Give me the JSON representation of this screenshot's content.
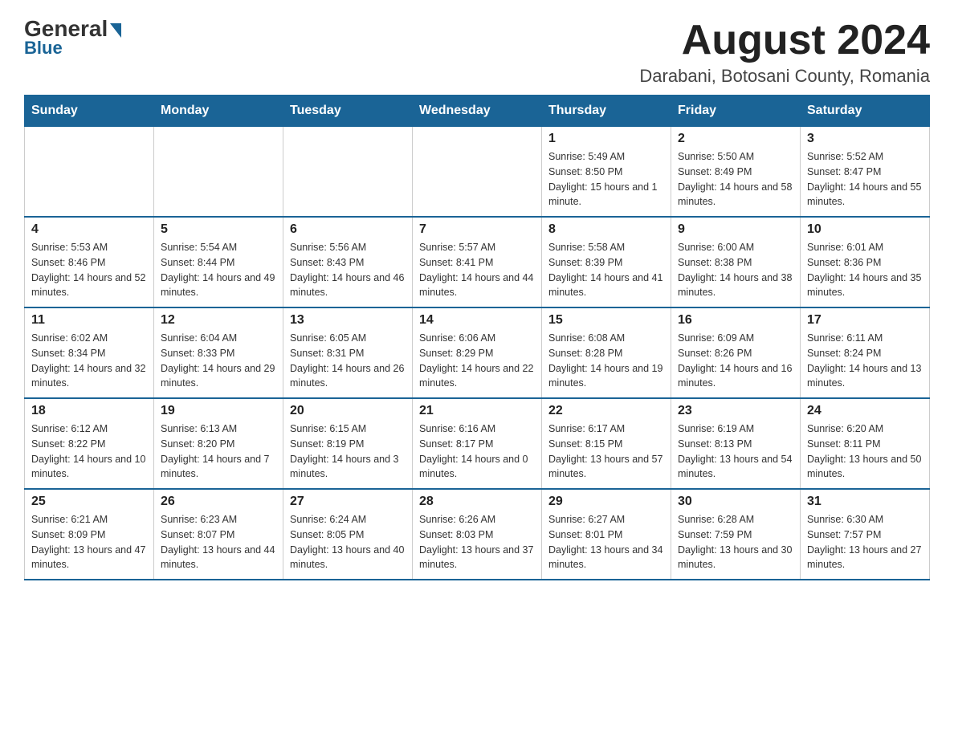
{
  "logo": {
    "general_text": "General",
    "blue_text": "Blue"
  },
  "header": {
    "month_year": "August 2024",
    "location": "Darabani, Botosani County, Romania"
  },
  "days_of_week": [
    "Sunday",
    "Monday",
    "Tuesday",
    "Wednesday",
    "Thursday",
    "Friday",
    "Saturday"
  ],
  "weeks": [
    {
      "days": [
        {
          "number": "",
          "info": ""
        },
        {
          "number": "",
          "info": ""
        },
        {
          "number": "",
          "info": ""
        },
        {
          "number": "",
          "info": ""
        },
        {
          "number": "1",
          "info": "Sunrise: 5:49 AM\nSunset: 8:50 PM\nDaylight: 15 hours and 1 minute."
        },
        {
          "number": "2",
          "info": "Sunrise: 5:50 AM\nSunset: 8:49 PM\nDaylight: 14 hours and 58 minutes."
        },
        {
          "number": "3",
          "info": "Sunrise: 5:52 AM\nSunset: 8:47 PM\nDaylight: 14 hours and 55 minutes."
        }
      ]
    },
    {
      "days": [
        {
          "number": "4",
          "info": "Sunrise: 5:53 AM\nSunset: 8:46 PM\nDaylight: 14 hours and 52 minutes."
        },
        {
          "number": "5",
          "info": "Sunrise: 5:54 AM\nSunset: 8:44 PM\nDaylight: 14 hours and 49 minutes."
        },
        {
          "number": "6",
          "info": "Sunrise: 5:56 AM\nSunset: 8:43 PM\nDaylight: 14 hours and 46 minutes."
        },
        {
          "number": "7",
          "info": "Sunrise: 5:57 AM\nSunset: 8:41 PM\nDaylight: 14 hours and 44 minutes."
        },
        {
          "number": "8",
          "info": "Sunrise: 5:58 AM\nSunset: 8:39 PM\nDaylight: 14 hours and 41 minutes."
        },
        {
          "number": "9",
          "info": "Sunrise: 6:00 AM\nSunset: 8:38 PM\nDaylight: 14 hours and 38 minutes."
        },
        {
          "number": "10",
          "info": "Sunrise: 6:01 AM\nSunset: 8:36 PM\nDaylight: 14 hours and 35 minutes."
        }
      ]
    },
    {
      "days": [
        {
          "number": "11",
          "info": "Sunrise: 6:02 AM\nSunset: 8:34 PM\nDaylight: 14 hours and 32 minutes."
        },
        {
          "number": "12",
          "info": "Sunrise: 6:04 AM\nSunset: 8:33 PM\nDaylight: 14 hours and 29 minutes."
        },
        {
          "number": "13",
          "info": "Sunrise: 6:05 AM\nSunset: 8:31 PM\nDaylight: 14 hours and 26 minutes."
        },
        {
          "number": "14",
          "info": "Sunrise: 6:06 AM\nSunset: 8:29 PM\nDaylight: 14 hours and 22 minutes."
        },
        {
          "number": "15",
          "info": "Sunrise: 6:08 AM\nSunset: 8:28 PM\nDaylight: 14 hours and 19 minutes."
        },
        {
          "number": "16",
          "info": "Sunrise: 6:09 AM\nSunset: 8:26 PM\nDaylight: 14 hours and 16 minutes."
        },
        {
          "number": "17",
          "info": "Sunrise: 6:11 AM\nSunset: 8:24 PM\nDaylight: 14 hours and 13 minutes."
        }
      ]
    },
    {
      "days": [
        {
          "number": "18",
          "info": "Sunrise: 6:12 AM\nSunset: 8:22 PM\nDaylight: 14 hours and 10 minutes."
        },
        {
          "number": "19",
          "info": "Sunrise: 6:13 AM\nSunset: 8:20 PM\nDaylight: 14 hours and 7 minutes."
        },
        {
          "number": "20",
          "info": "Sunrise: 6:15 AM\nSunset: 8:19 PM\nDaylight: 14 hours and 3 minutes."
        },
        {
          "number": "21",
          "info": "Sunrise: 6:16 AM\nSunset: 8:17 PM\nDaylight: 14 hours and 0 minutes."
        },
        {
          "number": "22",
          "info": "Sunrise: 6:17 AM\nSunset: 8:15 PM\nDaylight: 13 hours and 57 minutes."
        },
        {
          "number": "23",
          "info": "Sunrise: 6:19 AM\nSunset: 8:13 PM\nDaylight: 13 hours and 54 minutes."
        },
        {
          "number": "24",
          "info": "Sunrise: 6:20 AM\nSunset: 8:11 PM\nDaylight: 13 hours and 50 minutes."
        }
      ]
    },
    {
      "days": [
        {
          "number": "25",
          "info": "Sunrise: 6:21 AM\nSunset: 8:09 PM\nDaylight: 13 hours and 47 minutes."
        },
        {
          "number": "26",
          "info": "Sunrise: 6:23 AM\nSunset: 8:07 PM\nDaylight: 13 hours and 44 minutes."
        },
        {
          "number": "27",
          "info": "Sunrise: 6:24 AM\nSunset: 8:05 PM\nDaylight: 13 hours and 40 minutes."
        },
        {
          "number": "28",
          "info": "Sunrise: 6:26 AM\nSunset: 8:03 PM\nDaylight: 13 hours and 37 minutes."
        },
        {
          "number": "29",
          "info": "Sunrise: 6:27 AM\nSunset: 8:01 PM\nDaylight: 13 hours and 34 minutes."
        },
        {
          "number": "30",
          "info": "Sunrise: 6:28 AM\nSunset: 7:59 PM\nDaylight: 13 hours and 30 minutes."
        },
        {
          "number": "31",
          "info": "Sunrise: 6:30 AM\nSunset: 7:57 PM\nDaylight: 13 hours and 27 minutes."
        }
      ]
    }
  ]
}
